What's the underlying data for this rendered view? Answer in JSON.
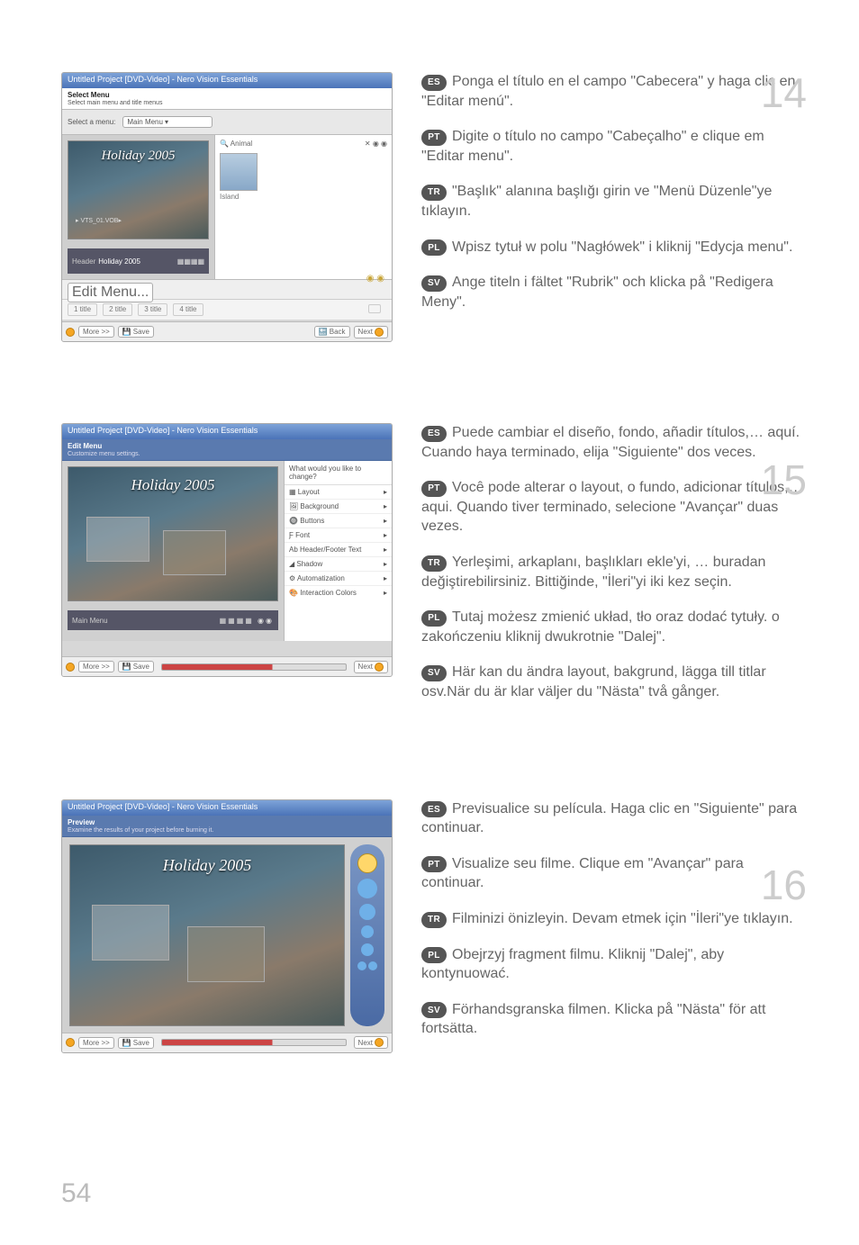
{
  "page_number": "54",
  "screenshot_window_title": "Untitled Project [DVD-Video] - Nero Vision Essentials",
  "menu_title_text": "Holiday 2005",
  "shot14": {
    "heading": "Select Menu",
    "sub": "Select main menu and title menus",
    "select_label": "Select a menu:",
    "dropdown": "Main Menu",
    "panel_label": "Animal",
    "panel_sub": "Island",
    "thumb_label": "Holiday 2005",
    "edit_button": "Edit Menu...",
    "clips": [
      "1 title",
      "2 title",
      "3 title",
      "4 title"
    ],
    "footer_more": "More >>",
    "footer_save": "Save",
    "footer_back": "Back",
    "footer_next": "Next"
  },
  "shot15": {
    "heading": "Edit Menu",
    "sub": "Customize menu settings.",
    "side_title": "What would you like to change?",
    "side_items": [
      "Layout",
      "Background",
      "Buttons",
      "Font",
      "Header/Footer Text",
      "Shadow",
      "Automatization",
      "Interaction Colors"
    ],
    "strip_label": "Main Menu",
    "footer_more": "More >>",
    "footer_save": "Save",
    "footer_next": "Next"
  },
  "shot16": {
    "heading": "Preview",
    "sub": "Examine the results of your project before burning it.",
    "footer_more": "More >>",
    "footer_save": "Save",
    "footer_next": "Next"
  },
  "steps": {
    "14": {
      "num": "14",
      "ES": "Ponga el título en el campo \"Cabecera\" y haga clic en \"Editar menú\".",
      "PT": "Digite o título no campo \"Cabeçalho\" e clique em \"Editar menu\".",
      "TR": "\"Başlık\" alanına başlığı girin ve \"Menü Düzenle\"ye tıklayın.",
      "PL": "Wpisz tytuł w polu \"Nagłówek\" i kliknij \"Edycja menu\".",
      "SV": "Ange titeln i fältet \"Rubrik\" och klicka på \"Redigera Meny\"."
    },
    "15": {
      "num": "15",
      "ES": "Puede cambiar el diseño, fondo, añadir títulos,… aquí. Cuando haya terminado, elija \"Siguiente\" dos veces.",
      "PT": "Você pode alterar o layout, o fundo, adicionar títulos,… aqui. Quando tiver terminado, selecione \"Avançar\" duas vezes.",
      "TR": "Yerleşimi, arkaplanı, başlıkları ekle'yi, … buradan değiştirebilirsiniz. Bittiğinde, \"İleri\"yi iki kez seçin.",
      "PL": "Tutaj możesz zmienić układ, tło oraz dodać tytuły. o zakończeniu kliknij dwukrotnie \"Dalej\".",
      "SV": "Här kan du ändra layout, bakgrund, lägga till titlar osv.När du är klar väljer du \"Nästa\" två gånger."
    },
    "16": {
      "num": "16",
      "ES": "Previsualice su película. Haga clic en \"Siguiente\" para continuar.",
      "PT": "Visualize seu filme. Clique em \"Avançar\" para continuar.",
      "TR": "Filminizi önizleyin. Devam etmek için \"İleri\"ye tıklayın.",
      "PL": "Obejrzyj fragment filmu. Kliknij \"Dalej\", aby kontynuować.",
      "SV": "Förhandsgranska filmen. Klicka på \"Nästa\" för att fortsätta."
    }
  },
  "lang_badges": {
    "ES": "ES",
    "PT": "PT",
    "TR": "TR",
    "PL": "PL",
    "SV": "SV"
  }
}
